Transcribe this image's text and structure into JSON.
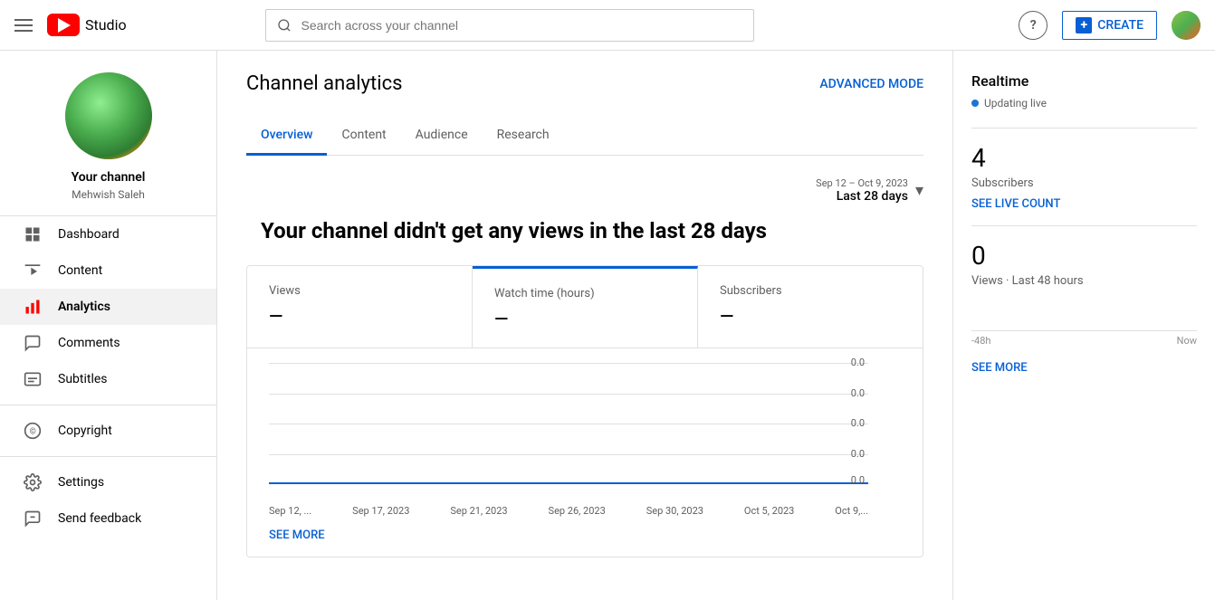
{
  "header": {
    "menu_icon": "hamburger-icon",
    "logo_text": "Studio",
    "search_placeholder": "Search across your channel",
    "help_label": "?",
    "create_label": "CREATE",
    "avatar_alt": "User avatar"
  },
  "sidebar": {
    "channel_name": "Your channel",
    "channel_handle": "Mehwish Saleh",
    "nav_items": [
      {
        "id": "dashboard",
        "label": "Dashboard",
        "icon": "dashboard-icon"
      },
      {
        "id": "content",
        "label": "Content",
        "icon": "content-icon"
      },
      {
        "id": "analytics",
        "label": "Analytics",
        "icon": "analytics-icon",
        "active": true
      },
      {
        "id": "comments",
        "label": "Comments",
        "icon": "comments-icon"
      },
      {
        "id": "subtitles",
        "label": "Subtitles",
        "icon": "subtitles-icon"
      },
      {
        "id": "copyright",
        "label": "Copyright",
        "icon": "copyright-icon"
      },
      {
        "id": "settings",
        "label": "Settings",
        "icon": "settings-icon"
      },
      {
        "id": "send-feedback",
        "label": "Send feedback",
        "icon": "feedback-icon"
      }
    ]
  },
  "page": {
    "title": "Channel analytics",
    "advanced_mode_label": "ADVANCED MODE",
    "tabs": [
      {
        "id": "overview",
        "label": "Overview",
        "active": true
      },
      {
        "id": "content",
        "label": "Content"
      },
      {
        "id": "audience",
        "label": "Audience"
      },
      {
        "id": "research",
        "label": "Research"
      }
    ],
    "date_range": {
      "sub": "Sep 12 – Oct 9, 2023",
      "main": "Last 28 days"
    },
    "empty_message": "Your channel didn't get any views in the last 28 days",
    "stats": [
      {
        "label": "Views",
        "value": "—",
        "active": false
      },
      {
        "label": "Watch time (hours)",
        "value": "—",
        "active": true
      },
      {
        "label": "Subscribers",
        "value": "—",
        "active": false
      }
    ],
    "chart": {
      "y_values": [
        "0.0",
        "0.0",
        "0.0",
        "0.0",
        "0.0"
      ],
      "x_labels": [
        "Sep 12, ...",
        "Sep 17, 2023",
        "Sep 21, 2023",
        "Sep 26, 2023",
        "Sep 30, 2023",
        "Oct 5, 2023",
        "Oct 9,..."
      ]
    },
    "see_more_label": "SEE MORE"
  },
  "right_panel": {
    "title": "Realtime",
    "live_text": "Updating live",
    "subscribers_value": "4",
    "subscribers_label": "Subscribers",
    "see_live_label": "SEE LIVE COUNT",
    "views_value": "0",
    "views_label": "Views · Last 48 hours",
    "time_start": "-48h",
    "time_end": "Now",
    "see_more_label": "SEE MORE"
  }
}
